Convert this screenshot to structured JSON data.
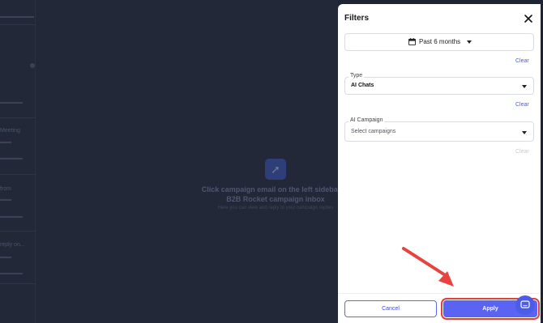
{
  "filters_panel": {
    "title": "Filters",
    "date_range": {
      "value": "Past 6 months"
    },
    "date_clear": "Clear",
    "type": {
      "label": "Type",
      "value": "AI Chats"
    },
    "type_clear": "Clear",
    "ai_campaign": {
      "label": "AI Campaign",
      "placeholder": "Select campaigns"
    },
    "campaign_clear": "Clear",
    "cancel_label": "Cancel",
    "apply_label": "Apply"
  },
  "background": {
    "empty_state_line1": "Click campaign email on the left sidebar to",
    "empty_state_line2": "B2B Rocket campaign inbox",
    "empty_state_line3": "Here you can view and reply to your campaign replies",
    "list_names": [
      "Meeting",
      "from",
      "reply on..."
    ]
  },
  "colors": {
    "overlay": "#222838",
    "accent": "#5a63f2",
    "clear_link": "#4a5be8",
    "highlight": "#e0413e"
  },
  "icons": {
    "close": "close-icon",
    "calendar": "calendar-icon",
    "chat": "chat-bubble-icon"
  }
}
